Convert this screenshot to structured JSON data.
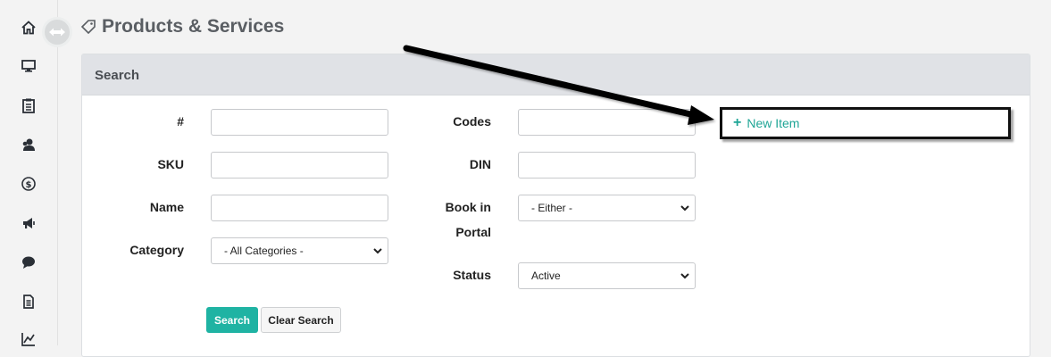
{
  "page": {
    "title": "Products & Services"
  },
  "sidebar": {
    "items": [
      {
        "icon": "home-icon"
      },
      {
        "icon": "monitor-icon"
      },
      {
        "icon": "clipboard-icon"
      },
      {
        "icon": "users-icon"
      },
      {
        "icon": "dollar-icon"
      },
      {
        "icon": "megaphone-icon"
      },
      {
        "icon": "chat-icon"
      },
      {
        "icon": "document-icon"
      },
      {
        "icon": "chart-icon"
      }
    ]
  },
  "search": {
    "header": "Search",
    "fields": {
      "number_label": "#",
      "sku_label": "SKU",
      "name_label": "Name",
      "category_label": "Category",
      "category_value": "- All Categories -",
      "codes_label": "Codes",
      "din_label": "DIN",
      "book_label_line1": "Book in",
      "book_label_line2": "Portal",
      "book_value": "- Either -",
      "status_label": "Status",
      "status_value": "Active"
    },
    "search_button": "Search",
    "clear_button": "Clear Search"
  },
  "actions": {
    "new_item_label": "New Item",
    "new_item_plus": "+"
  },
  "colors": {
    "accent": "#1fb3a3",
    "header_bg": "#e0e2e6"
  }
}
